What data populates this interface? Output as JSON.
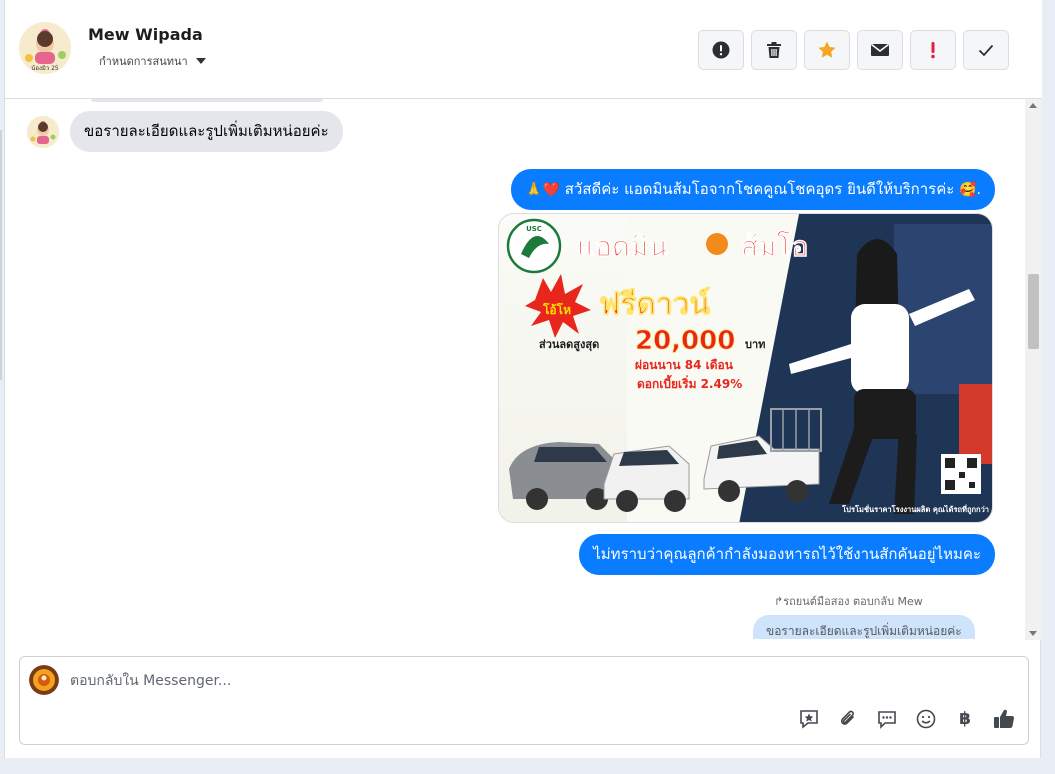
{
  "header": {
    "contact_name": "Mew Wipada",
    "assign_label": "กำหนดการสนทนา",
    "avatar_caption": "น้องมิว 25",
    "toolbar": [
      {
        "name": "spam-report-button",
        "icon": "exclamation-circle-icon"
      },
      {
        "name": "delete-button",
        "icon": "trash-icon"
      },
      {
        "name": "star-button",
        "icon": "star-icon",
        "color": "#f5a623"
      },
      {
        "name": "mark-unread-button",
        "icon": "envelope-icon"
      },
      {
        "name": "follow-up-button",
        "icon": "exclamation-icon",
        "color": "#e41e3f"
      },
      {
        "name": "mark-done-button",
        "icon": "checkmark-icon"
      }
    ]
  },
  "thread": {
    "incoming_1": "ขอรายละเอียดและรูปเพิ่มเติมหน่อยค่ะ",
    "outgoing_1": {
      "emoji_prefix": "🙏❤️",
      "text": "สวัสดีค่ะ แอดมินส้มโอจากโชคคูณโชคอุดร ยินดีให้บริการค่ะ",
      "emoji_suffix": "🥰."
    },
    "photo": {
      "headline_1": "แอดมิน",
      "headline_2": "ส้มโอ",
      "burst": "โอ้โห",
      "promo": "ฟรีดาวน์",
      "discount_label": "ส่วนลดสูงสุด",
      "discount_value": "20,000",
      "discount_unit": "บาท",
      "installment": "ผ่อนนาน 84 เดือน",
      "interest": "ดอกเบี้ยเริ่ม 2.49%",
      "footer": "โปรโมชั่นราคาโรงงานผลิต คุณได้รถที่ถูกกว่า",
      "logo": "USC"
    },
    "outgoing_2": "ไม่ทราบว่าคุณลูกค้ากำลังมองหารถไว้ใช้งานสักคันอยู่ไหมคะ",
    "reply_note": "รถยนต์มือสอง ตอบกลับ Mew",
    "reply_quote": "ขอรายละเอียดและรูปเพิ่มเติมหน่อยค่ะ"
  },
  "composer": {
    "placeholder": "ตอบกลับใน Messenger...",
    "tools": [
      "saved-reply-icon",
      "attachment-icon",
      "quick-replies-icon",
      "emoji-icon",
      "baht-icon",
      "thumbs-up-icon"
    ],
    "baht_symbol": "฿"
  },
  "colors": {
    "outgoing_bubble": "#0a7cff",
    "incoming_bubble": "#e4e6eb",
    "reply_quote": "#cfe3fb"
  }
}
